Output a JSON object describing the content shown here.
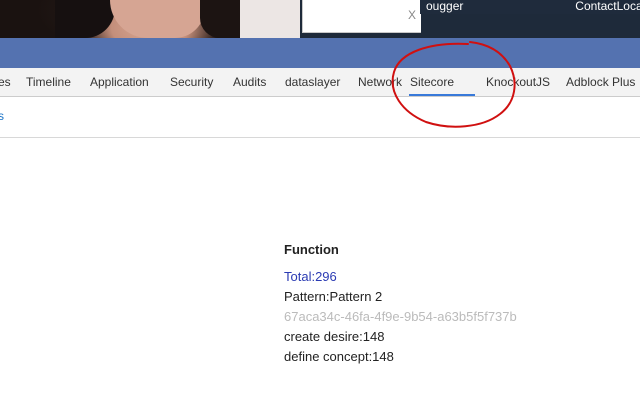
{
  "page": {
    "popup_close": "X",
    "top_tabs": {
      "debugger": "ougger",
      "contact": "ContactLocat"
    }
  },
  "devtools": {
    "tabs": [
      {
        "label": "es"
      },
      {
        "label": "Timeline"
      },
      {
        "label": "Application"
      },
      {
        "label": "Security"
      },
      {
        "label": "Audits"
      },
      {
        "label": "dataslayer"
      },
      {
        "label": "Network"
      },
      {
        "label": "Sitecore",
        "active": true
      },
      {
        "label": "KnockoutJS"
      },
      {
        "label": "Adblock Plus"
      }
    ],
    "sub_link": "s"
  },
  "panel": {
    "title": "Function",
    "total": "Total:296",
    "pattern": "Pattern:Pattern 2",
    "guid": "67aca34c-46fa-4f9e-9b54-a63b5f5f737b",
    "stats": [
      "create desire:148",
      "define concept:148"
    ]
  },
  "colors": {
    "accent_bar": "#5472b0",
    "active_tab_underline": "#3879d9",
    "total_text": "#2b3bb3",
    "guid_text": "#bbbbbb",
    "annotation_circle": "#d01010"
  },
  "icons": {
    "popup_close": "close-icon"
  }
}
